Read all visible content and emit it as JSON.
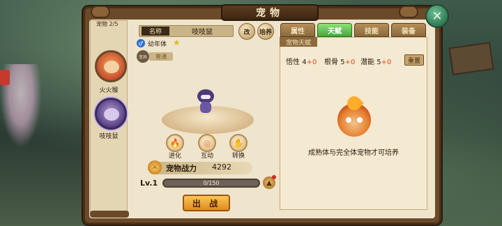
{
  "window": {
    "title": "宠物",
    "close_label": "✕"
  },
  "pet_list": {
    "count": "宠物 2/5",
    "pets": [
      {
        "name": "火火猴"
      },
      {
        "name": "吱吱鼠"
      }
    ]
  },
  "pet_detail": {
    "name_label": "名称",
    "name_value": "吱吱鼠",
    "rename_icon_label": "改",
    "feed_icon_label": "培养",
    "stage": "幼年体",
    "variant_badge": "变异",
    "variant_tag": "普通",
    "actions": [
      {
        "label": "进化",
        "icon": "flame-icon"
      },
      {
        "label": "互动",
        "icon": "swirl-icon"
      },
      {
        "label": "转换",
        "icon": "hand-icon"
      }
    ],
    "power_label": "宠物战力",
    "power_value": "4292",
    "level": "Lv.1",
    "exp_text": "0/150",
    "exp_progress": 0,
    "deploy_label": "出 战"
  },
  "tabs": [
    {
      "label": "属性",
      "active": false
    },
    {
      "label": "天赋",
      "active": true
    },
    {
      "label": "技能",
      "active": false
    },
    {
      "label": "装备",
      "active": false
    }
  ],
  "talent": {
    "section_title": "宠物天赋",
    "stats": [
      {
        "name": "悟性",
        "value": "4",
        "bonus": "+0"
      },
      {
        "name": "根骨",
        "value": "5",
        "bonus": "+0"
      },
      {
        "name": "潜能",
        "value": "5",
        "bonus": "+0"
      }
    ],
    "reset_label": "重置",
    "hint": "成熟体与完全体宠物才可培养"
  },
  "colors": {
    "active_tab": "#45a83a",
    "accent": "#e18a1e",
    "bonus": "#e04b1f"
  }
}
